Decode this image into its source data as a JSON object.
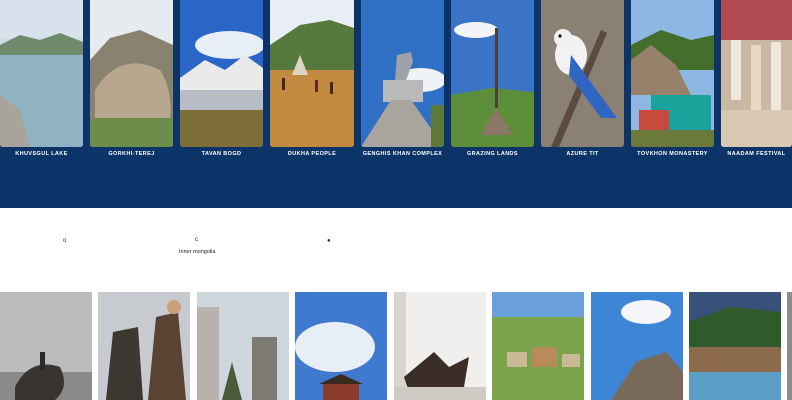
{
  "top_gallery": {
    "cards": [
      {
        "caption": "KHUVSGUL LAKE"
      },
      {
        "caption": "GORKHI-TEREJ"
      },
      {
        "caption": "TAVAN BOGD"
      },
      {
        "caption": "DUKHA PEOPLE"
      },
      {
        "caption": "GENGHIS KHAN COMPLEX"
      },
      {
        "caption": "GRAZING LANDS"
      },
      {
        "caption": "AZURE TIT"
      },
      {
        "caption": "TOVKHON MONASTERY"
      },
      {
        "caption": "NAADAM FESTIVAL"
      }
    ]
  },
  "map_area": {
    "marker_a": "o",
    "marker_b": "c",
    "marker_c": "●",
    "region_label": "Inner mongolia"
  },
  "colors": {
    "band": "#0d3468",
    "page_bg": "#ffffff"
  }
}
